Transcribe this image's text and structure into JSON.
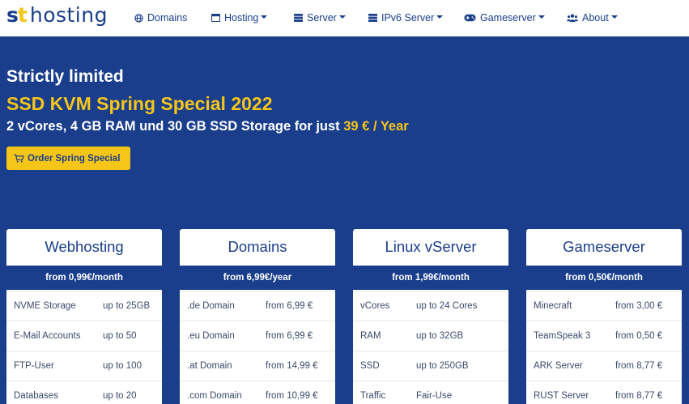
{
  "brand": {
    "logo_st": "st",
    "logo_text": "hosting"
  },
  "nav": {
    "items": [
      {
        "label": "Domains",
        "icon": "globe-icon",
        "dropdown": false
      },
      {
        "label": "Hosting",
        "icon": "window-icon",
        "dropdown": true
      },
      {
        "label": "Server",
        "icon": "server-icon",
        "dropdown": true
      },
      {
        "label": "IPv6 Server",
        "icon": "server-icon",
        "dropdown": true
      },
      {
        "label": "Gameserver",
        "icon": "gamepad-icon",
        "dropdown": true
      },
      {
        "label": "About",
        "icon": "users-icon",
        "dropdown": true
      }
    ]
  },
  "hero": {
    "subtitle": "Strictly limited",
    "title": "SSD KVM Spring Special 2022",
    "desc_prefix": "2 vCores, 4 GB RAM und 30 GB SSD Storage for just ",
    "desc_price": "39 € / Year",
    "order_label": "Order Spring Special",
    "order_icon": "cart-icon"
  },
  "colors": {
    "brand_blue": "#1a3e8c",
    "accent_yellow": "#f5c518",
    "white": "#ffffff"
  },
  "cards": [
    {
      "title": "Webhosting",
      "price": "from 0,99€/month",
      "features": [
        {
          "name": "NVME Storage",
          "value": "up to 25GB"
        },
        {
          "name": "E-Mail Accounts",
          "value": "up to 50"
        },
        {
          "name": "FTP-User",
          "value": "up to 100"
        },
        {
          "name": "Databases",
          "value": "up to 20"
        }
      ]
    },
    {
      "title": "Domains",
      "price": "from 6,99€/year",
      "features": [
        {
          "name": ".de Domain",
          "value": "from 6,99 €"
        },
        {
          "name": ".eu Domain",
          "value": "from 6,99 €"
        },
        {
          "name": ".at Domain",
          "value": "from 14,99 €"
        },
        {
          "name": ".com Domain",
          "value": "from 10,99 €"
        }
      ]
    },
    {
      "title": "Linux vServer",
      "price": "from 1,99€/month",
      "features": [
        {
          "name": "vCores",
          "value": "up to 24 Cores"
        },
        {
          "name": "RAM",
          "value": "up to 32GB"
        },
        {
          "name": "SSD",
          "value": "up to 250GB"
        },
        {
          "name": "Traffic",
          "value": "Fair-Use"
        }
      ]
    },
    {
      "title": "Gameserver",
      "price": "from 0,50€/month",
      "features": [
        {
          "name": "Minecraft",
          "value": "from 3,00 €"
        },
        {
          "name": "TeamSpeak 3",
          "value": "from 0,50 €"
        },
        {
          "name": "ARK Server",
          "value": "from 8,77 €"
        },
        {
          "name": "RUST Server",
          "value": "from 8,77 €"
        }
      ]
    }
  ]
}
